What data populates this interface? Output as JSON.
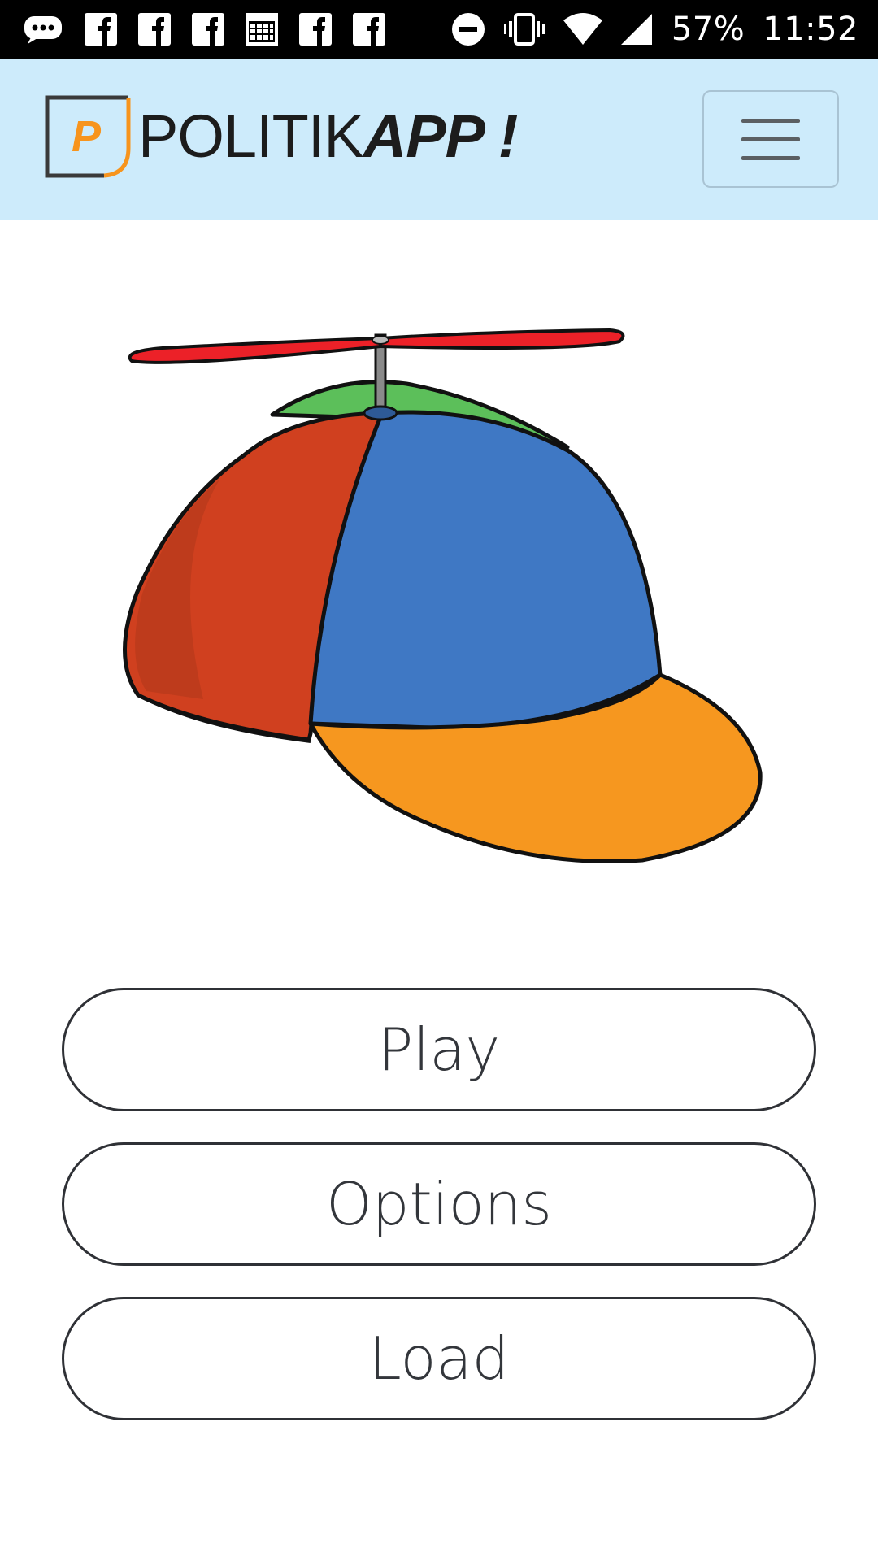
{
  "status_bar": {
    "battery_percent": "57%",
    "time": "11:52",
    "left_icons": [
      "message-dots-icon",
      "facebook-icon",
      "facebook-icon",
      "facebook-icon",
      "calendar-grid-icon",
      "facebook-icon",
      "facebook-icon"
    ],
    "right_icons": [
      "do-not-disturb-icon",
      "vibrate-icon",
      "wifi-icon",
      "cell-signal-icon"
    ]
  },
  "header": {
    "logo_letter": "P",
    "brand_light": "POLITIK",
    "brand_bold": "APP !",
    "menu_icon": "hamburger-icon"
  },
  "hero": {
    "image": "propeller-cap-illustration"
  },
  "buttons": {
    "play_label": "Play",
    "options_label": "Options",
    "load_label": "Load"
  },
  "colors": {
    "header_background": "#cdebfb",
    "logo_accent": "#f7941d",
    "cap_red": "#d0401f",
    "cap_blue": "#3f78c4",
    "cap_green": "#5cbf5a",
    "cap_visor": "#f6971f",
    "propeller": "#ec2128"
  }
}
